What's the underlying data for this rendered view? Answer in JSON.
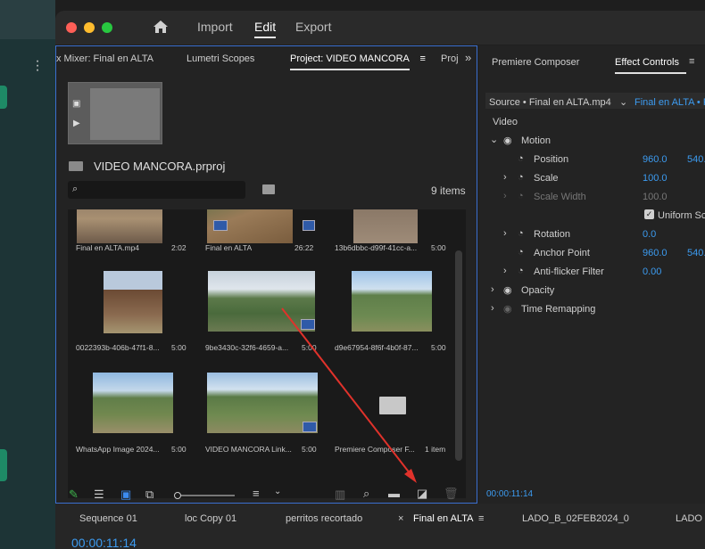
{
  "menu": {
    "import": "Import",
    "edit": "Edit",
    "export": "Export"
  },
  "project_panel": {
    "tabs": [
      "x Mixer: Final en ALTA",
      "Lumetri Scopes",
      "Project: VIDEO MANCORA",
      "Proj"
    ],
    "project_name": "VIDEO MANCORA.prproj",
    "search_placeholder": "",
    "item_count": "9 items",
    "clips": [
      {
        "name": "Final en ALTA.mp4",
        "duration": "2:02"
      },
      {
        "name": "Final en ALTA",
        "duration": "26:22"
      },
      {
        "name": "13b6dbbc-d99f-41cc-a...",
        "duration": "5:00"
      },
      {
        "name": "0022393b-406b-47f1-8...",
        "duration": "5:00"
      },
      {
        "name": "9be3430c-32f6-4659-a...",
        "duration": "5:00"
      },
      {
        "name": "d9e67954-8f6f-4b0f-87...",
        "duration": "5:00"
      },
      {
        "name": "WhatsApp Image 2024...",
        "duration": "5:00"
      },
      {
        "name": "VIDEO MANCORA Link...",
        "duration": "5:00"
      },
      {
        "name": "Premiere Composer F...",
        "duration": "1 item"
      }
    ]
  },
  "effect_controls": {
    "tabs": [
      "Premiere Composer",
      "Effect Controls"
    ],
    "source": "Source • Final en ALTA.mp4",
    "sequence": "Final en ALTA • F",
    "section": "Video",
    "motion": "Motion",
    "position": {
      "label": "Position",
      "x": "960.0",
      "y": "540."
    },
    "scale": {
      "label": "Scale",
      "value": "100.0"
    },
    "scale_width": {
      "label": "Scale Width",
      "value": "100.0"
    },
    "uniform_scale": "Uniform Sc",
    "rotation": {
      "label": "Rotation",
      "value": "0.0"
    },
    "anchor": {
      "label": "Anchor Point",
      "x": "960.0",
      "y": "540."
    },
    "antiflicker": {
      "label": "Anti-flicker Filter",
      "value": "0.00"
    },
    "opacity": "Opacity",
    "time_remap": "Time Remapping",
    "timecode": "00:00:11:14"
  },
  "timeline": {
    "tabs": [
      "Sequence 01",
      "loc Copy 01",
      "perritos recortado",
      "Final en ALTA",
      "LADO_B_02FEB2024_0",
      "LADO"
    ],
    "timecode": "00:00:11:14"
  },
  "colors": {
    "accent": "#3c9bf0",
    "panel_border": "#3b6fd0",
    "arrow": "#e0322b"
  }
}
